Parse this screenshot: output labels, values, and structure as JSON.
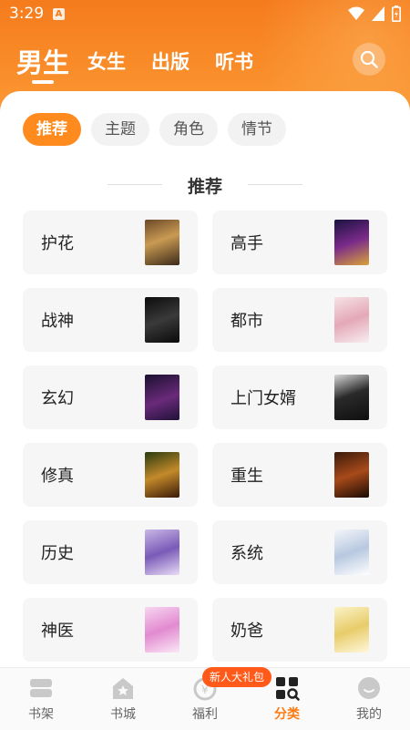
{
  "status": {
    "time": "3:29",
    "sim_letter": "A"
  },
  "header": {
    "tabs": [
      {
        "label": "男生",
        "active": true
      },
      {
        "label": "女生",
        "active": false
      },
      {
        "label": "出版",
        "active": false
      },
      {
        "label": "听书",
        "active": false
      }
    ],
    "search_icon": "search-icon"
  },
  "filters": [
    {
      "label": "推荐",
      "active": true
    },
    {
      "label": "主题",
      "active": false
    },
    {
      "label": "角色",
      "active": false
    },
    {
      "label": "情节",
      "active": false
    }
  ],
  "section": {
    "title": "推荐"
  },
  "categories": [
    {
      "label": "护花",
      "cover_text": ""
    },
    {
      "label": "高手",
      "cover_text": ""
    },
    {
      "label": "战神",
      "cover_text": ""
    },
    {
      "label": "都市",
      "cover_text": ""
    },
    {
      "label": "玄幻",
      "cover_text": ""
    },
    {
      "label": "上门女婿",
      "cover_text": ""
    },
    {
      "label": "修真",
      "cover_text": ""
    },
    {
      "label": "重生",
      "cover_text": ""
    },
    {
      "label": "历史",
      "cover_text": ""
    },
    {
      "label": "系统",
      "cover_text": ""
    },
    {
      "label": "神医",
      "cover_text": ""
    },
    {
      "label": "奶爸",
      "cover_text": ""
    }
  ],
  "colors": {
    "accent": "#ff8a1e",
    "header_start": "#f57b1c",
    "header_end": "#fb9c38"
  },
  "bottom_nav": {
    "items": [
      {
        "label": "书架",
        "icon": "bookshelf-icon",
        "active": false
      },
      {
        "label": "书城",
        "icon": "bookstore-icon",
        "active": false
      },
      {
        "label": "福利",
        "icon": "welfare-icon",
        "active": false
      },
      {
        "label": "分类",
        "icon": "category-icon",
        "active": true
      },
      {
        "label": "我的",
        "icon": "profile-icon",
        "active": false
      }
    ],
    "promo_badge": "新人大礼包"
  }
}
